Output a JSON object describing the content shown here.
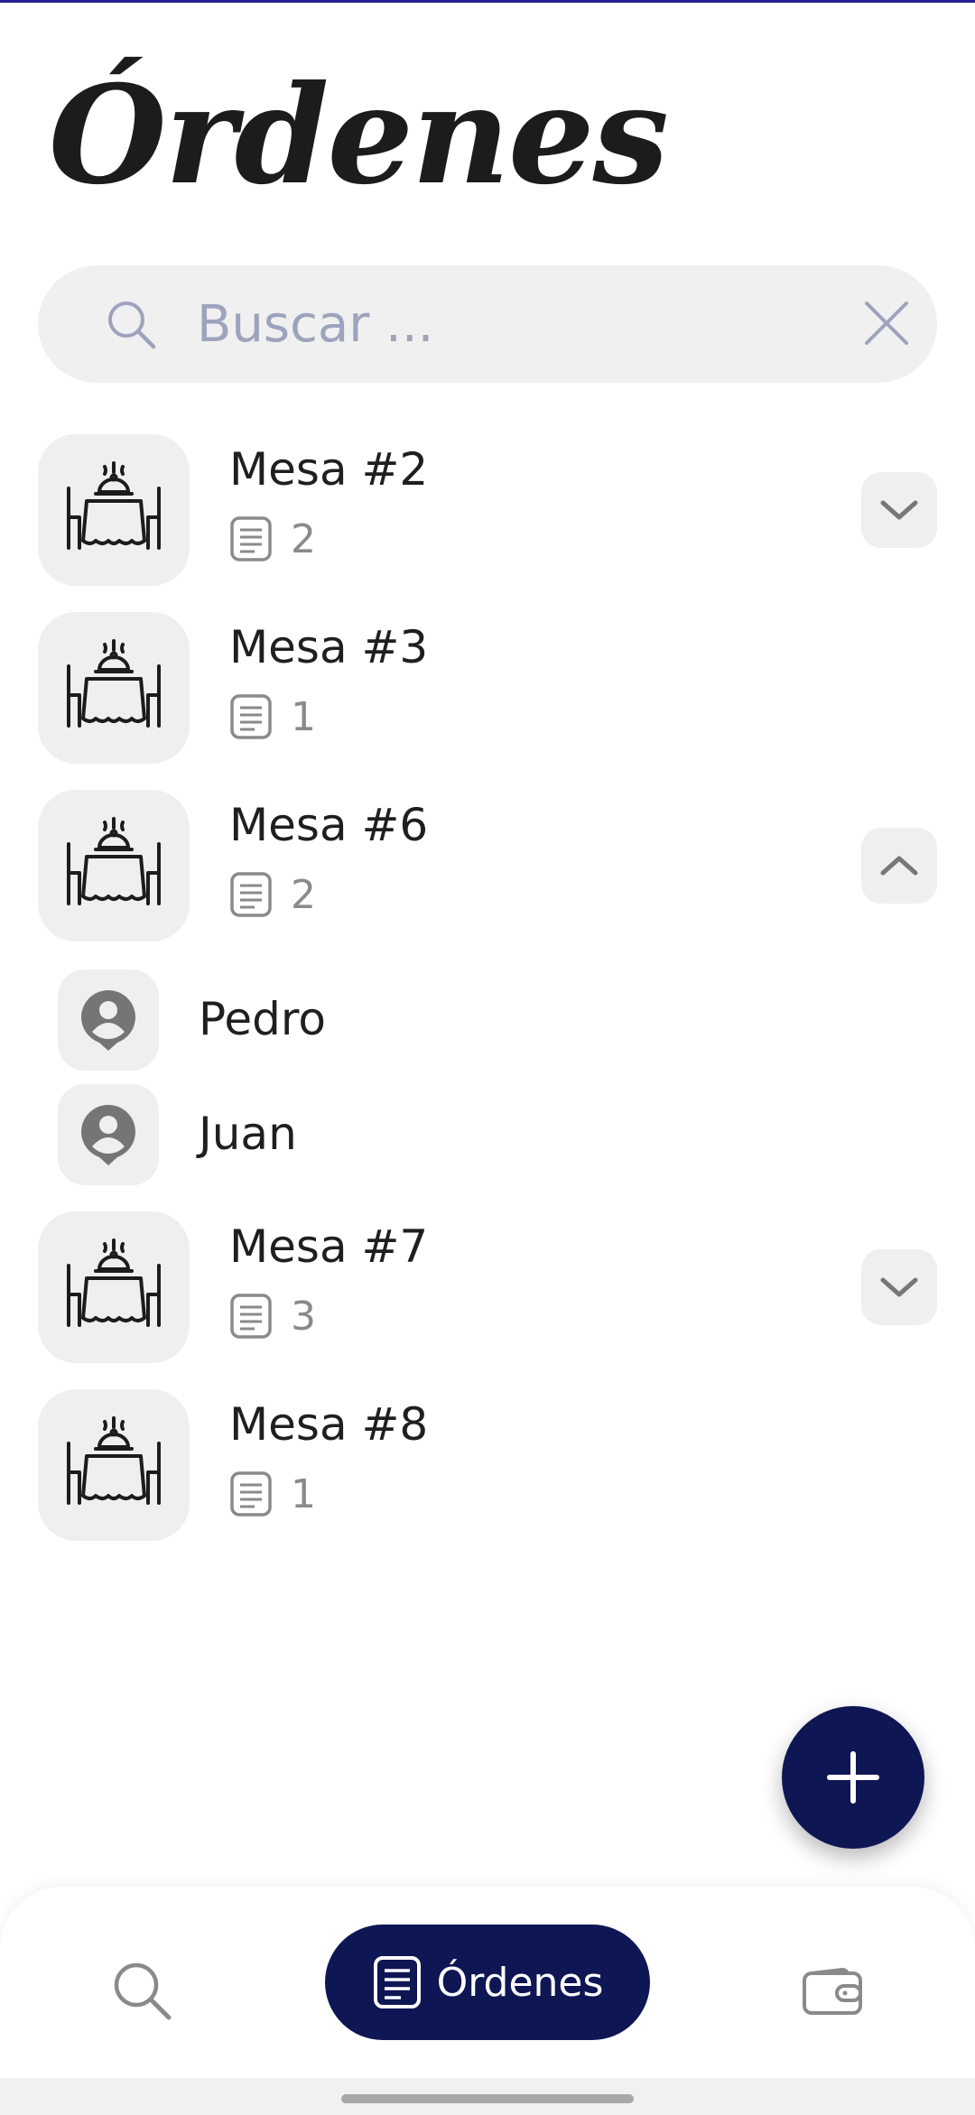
{
  "page": {
    "title": "Órdenes"
  },
  "search": {
    "placeholder": "Buscar ..."
  },
  "tables": [
    {
      "name": "Mesa #2",
      "orders": "2",
      "toggle": "chevron-down"
    },
    {
      "name": "Mesa #3",
      "orders": "1"
    },
    {
      "name": "Mesa #6",
      "orders": "2",
      "toggle": "chevron-up",
      "customers": [
        {
          "name": "Pedro"
        },
        {
          "name": "Juan"
        }
      ]
    },
    {
      "name": "Mesa #7",
      "orders": "3",
      "toggle": "chevron-down"
    },
    {
      "name": "Mesa #8",
      "orders": "1"
    }
  ],
  "fab": {
    "icon": "plus-icon"
  },
  "bottom_nav": {
    "items": [
      {
        "icon": "search-icon"
      },
      {
        "icon": "receipt-icon",
        "label": "Órdenes",
        "active": true
      },
      {
        "icon": "wallet-icon"
      }
    ]
  },
  "colors": {
    "accent": "#0f1654",
    "surface": "#efefef",
    "placeholder": "#9ea3bd",
    "muted": "#8a8a8a"
  }
}
